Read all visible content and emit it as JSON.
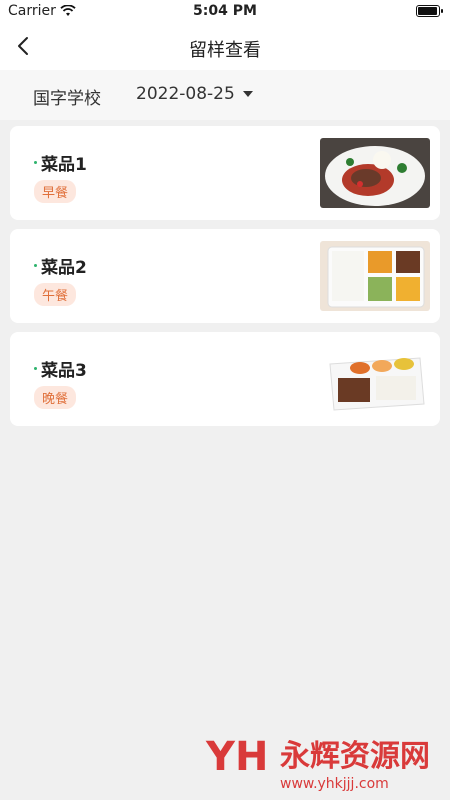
{
  "status": {
    "carrier": "Carrier",
    "time": "5:04 PM"
  },
  "nav": {
    "title": "留样查看"
  },
  "filter": {
    "school": "国字学校",
    "date": "2022-08-25"
  },
  "items": [
    {
      "name": "菜品1",
      "meal": "早餐",
      "image": "braised-meat-rice"
    },
    {
      "name": "菜品2",
      "meal": "午餐",
      "image": "bento-box"
    },
    {
      "name": "菜品3",
      "meal": "晚餐",
      "image": "meal-tray"
    }
  ],
  "watermark": {
    "brand": "永辉资源网",
    "url": "www.yhkjjj.com"
  }
}
